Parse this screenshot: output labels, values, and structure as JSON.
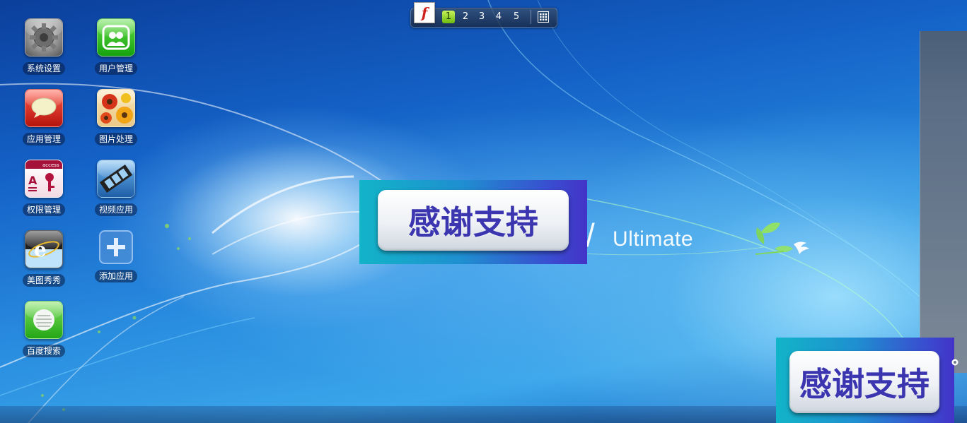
{
  "desktop": {
    "icons": [
      {
        "label": "系统设置",
        "icon": "gear-icon"
      },
      {
        "label": "用户管理",
        "icon": "users-icon"
      },
      {
        "label": "应用管理",
        "icon": "chat-bubble-icon"
      },
      {
        "label": "图片处理",
        "icon": "flowers-photo-icon"
      },
      {
        "label": "权限管理",
        "icon": "access-key-icon"
      },
      {
        "label": "视频应用",
        "icon": "film-strip-icon"
      },
      {
        "label": "美图秀秀",
        "icon": "internet-explorer-icon"
      },
      {
        "label": "添加应用",
        "icon": "plus-icon"
      },
      {
        "label": "百度搜索",
        "icon": "search-lines-icon"
      }
    ]
  },
  "dock": {
    "flash_glyph": "f",
    "pages": [
      "1",
      "2",
      "3",
      "4",
      "5"
    ],
    "active_page": "1",
    "grid_icon": "grid-icon"
  },
  "wallpaper": {
    "logo_text": "Ultimate"
  },
  "banners": {
    "center_text": "感谢支持",
    "corner_text": "感谢支持"
  },
  "colors": {
    "accent_green": "#8ad629",
    "banner_text": "#3b36b0"
  }
}
